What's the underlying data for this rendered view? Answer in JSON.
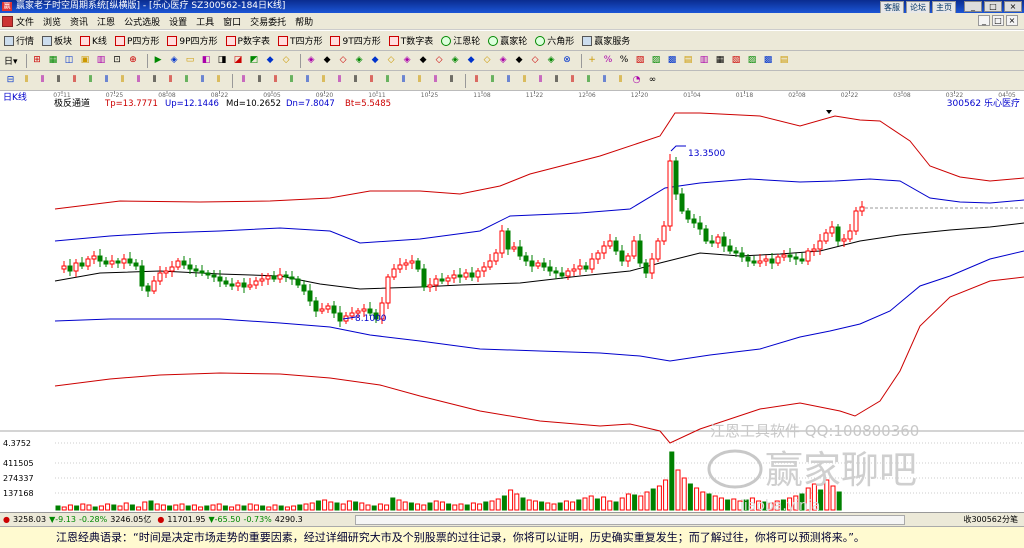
{
  "window": {
    "title": "赢家老子时空周期系统[纵横版] - [乐心医疗  SZ300562-184日K线]",
    "title_buttons": [
      "客服",
      "论坛",
      "主页"
    ],
    "window_controls": [
      "_",
      "□",
      "×"
    ]
  },
  "menu": {
    "items": [
      "文件",
      "浏览",
      "资讯",
      "江恩",
      "公式选股",
      "设置",
      "工具",
      "窗口",
      "交易委托",
      "帮助"
    ],
    "right_controls": [
      "_",
      "□",
      "×"
    ]
  },
  "toolbar1": {
    "items": [
      {
        "label": "行情",
        "icon": "market-icon"
      },
      {
        "label": "板块",
        "icon": "sector-icon"
      },
      {
        "label": "K线",
        "icon": "kline-icon"
      },
      {
        "label": "P四方形",
        "icon": "p-square-icon"
      },
      {
        "label": "9P四方形",
        "icon": "9p-square-icon"
      },
      {
        "label": "P数字表",
        "icon": "p-number-table-icon"
      },
      {
        "label": "T四方形",
        "icon": "t-square-icon"
      },
      {
        "label": "9T四方形",
        "icon": "9t-square-icon"
      },
      {
        "label": "T数字表",
        "icon": "t-number-table-icon"
      },
      {
        "label": "江恩轮",
        "icon": "gann-wheel-icon"
      },
      {
        "label": "赢家轮",
        "icon": "winner-wheel-icon"
      },
      {
        "label": "六角形",
        "icon": "hexagon-icon"
      },
      {
        "label": "赢家服务",
        "icon": "winner-service-icon"
      }
    ]
  },
  "toolbar2": {
    "period": "日",
    "period_arrow": "▾",
    "icons": [
      "⊞",
      "▦",
      "◫",
      "▣",
      "▥",
      "⊡",
      "⊕",
      "▶",
      "◈",
      "▭",
      "◧",
      "◨",
      "◪",
      "◩",
      "◆",
      "◇",
      "◈",
      "◆",
      "◇",
      "◈",
      "◆",
      "◇",
      "◈",
      "◆",
      "◇",
      "◈",
      "◆",
      "◇",
      "◈",
      "◆",
      "◇",
      "◈",
      "⊗",
      "+",
      "%",
      "%",
      "▧",
      "▨",
      "▩",
      "▤",
      "▥",
      "▦",
      "▧",
      "▨",
      "▩",
      "▤"
    ]
  },
  "toolbar3": {
    "icons": [
      "⊟",
      "⫴",
      "⫴",
      "⫴",
      "⫴",
      "⫴",
      "⫴",
      "⫴",
      "⫴",
      "⫴",
      "⫴",
      "⫴",
      "⫴",
      "⫴",
      "⫴",
      "⫴",
      "⫴",
      "⫴",
      "⫴",
      "⫴",
      "⫴",
      "⫴",
      "⫴",
      "⫴",
      "⫴",
      "⫴",
      "⫴",
      "⫴",
      "⫴",
      "⫴",
      "⫴",
      "⫴",
      "⫴",
      "⫴",
      "⫴",
      "⫴",
      "⫴",
      "⫴",
      "◔",
      "∞"
    ]
  },
  "chart": {
    "period_label": "日K线",
    "indicator_name": "极反通道",
    "indicators": [
      {
        "label": "Tp=13.7771",
        "color": "#cc0000"
      },
      {
        "label": "Up=12.1446",
        "color": "#0000cc"
      },
      {
        "label": "Md=10.2652",
        "color": "#000000"
      },
      {
        "label": "Dn=7.8047",
        "color": "#0000cc"
      },
      {
        "label": "Bt=5.5485",
        "color": "#cc0000"
      }
    ],
    "stock_label": "300562 乐心医疗",
    "date_ticks": [
      "07-11",
      "07-25",
      "08-08",
      "08-22",
      "09-05",
      "09-20",
      "10-11",
      "10-25",
      "11-08",
      "11-22",
      "12-06",
      "12-20",
      "01-04",
      "01-18",
      "02-08",
      "02-22",
      "03-08",
      "03-22",
      "04-05"
    ],
    "high_label": "13.3500",
    "low_label": "8.1000",
    "volume_axis": [
      "4.3752",
      "411505",
      "274337",
      "137168"
    ],
    "watermark_top": "江恩工具软件  QQ:100800360",
    "watermark_brand": "赢家聊吧",
    "watermark_url": "jiaoba.yinja"
  },
  "colors": {
    "up_candle": "#ff0000",
    "down_candle": "#008000",
    "top_band": "#cc0000",
    "upper_band": "#0000cc",
    "mid_band": "#000000"
  },
  "status": {
    "sh_index": "3258.03",
    "sh_change": "▼-9.13",
    "sh_pct": "-0.28%",
    "sh_amount": "3246.05亿",
    "sz_index": "11701.95",
    "sz_change": "▼-65.50",
    "sz_pct": "-0.73%",
    "sz_amount": "4290.3",
    "right_text": "收300562分笔"
  },
  "footer": {
    "quote": "江恩经典语录：“时间是决定市场走势的重要因素，经过详细研究大市及个别股票的过往记录，你将可以证明，历史确实重复发生；而了解过往，你将可以预测将来。”。"
  }
}
